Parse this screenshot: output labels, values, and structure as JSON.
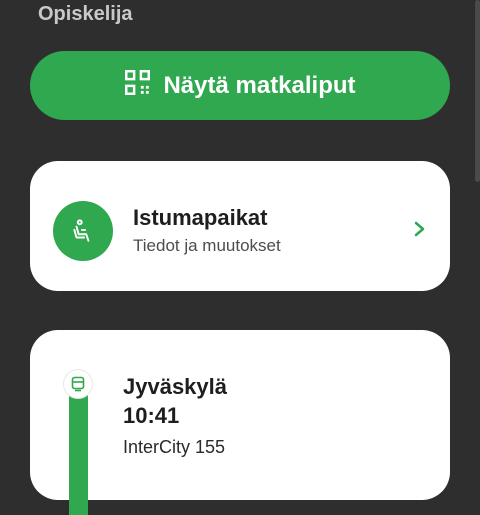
{
  "header": {
    "passenger_type": "Opiskelija"
  },
  "tickets_button": {
    "label": "Näytä matkaliput",
    "icon": "qr-code-icon"
  },
  "seats": {
    "title": "Istumapaikat",
    "subtitle": "Tiedot ja muutokset",
    "icon": "seat-icon"
  },
  "journey": {
    "station": "Jyväskylä",
    "time": "10:41",
    "train": "InterCity 155",
    "icon": "train-icon"
  },
  "colors": {
    "accent": "#2fa84f",
    "background": "#2e2e2e",
    "card": "#ffffff"
  }
}
